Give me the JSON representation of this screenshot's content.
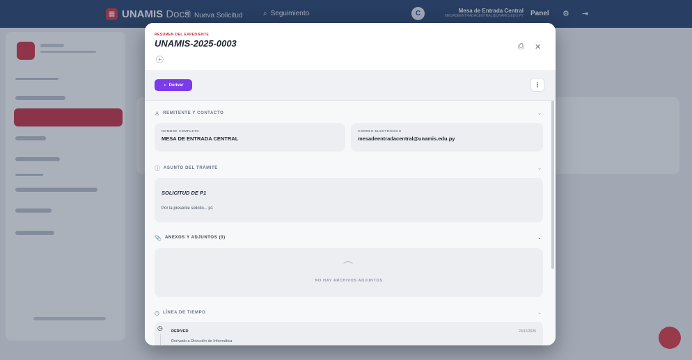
{
  "topbar": {
    "brand_main": "UNAMIS",
    "brand_sub": "Docs",
    "nav": [
      "Nueva Solicitud",
      "Seguimiento"
    ],
    "user_initial": "C",
    "user_name": "Mesa de Entrada Central",
    "user_email": "MESADEENTRADACENTRAL@UNAMIS.EDU.PY",
    "panel_label": "Panel"
  },
  "modal": {
    "kicker": "RESUMEN DEL EXPEDIENTE",
    "title": "UNAMIS-2025-0003",
    "add_tag": "+",
    "derivar_label": "Derivar",
    "more_label": "⋮"
  },
  "sections": {
    "sender": {
      "title": "REMITENTE Y CONTACTO",
      "name_label": "NOMBRE COMPLETO",
      "name_value": "MESA DE ENTRADA CENTRAL",
      "email_label": "CORREO ELECTRÓNICO",
      "email_value": "mesadeentradacentral@unamis.edu.py"
    },
    "subject": {
      "title": "ASUNTO DEL TRÁMITE",
      "heading": "SOLICITUD DE P1",
      "body": "Por la presente solicito... p1"
    },
    "attachments": {
      "title": "ANEXOS Y ADJUNTOS (0)",
      "empty_text": "NO HAY ARCHIVOS ADJUNTOS"
    },
    "timeline": {
      "title": "LÍNEA DE TIEMPO",
      "items": [
        {
          "status": "DERIVED",
          "description": "Derivado a Dirección de Informática",
          "date": "29/12/2025"
        }
      ]
    }
  },
  "colors": {
    "brand_red": "#d0283b",
    "derivar_purple": "#7c3aed",
    "topbar_navy": "#1e3a66"
  }
}
